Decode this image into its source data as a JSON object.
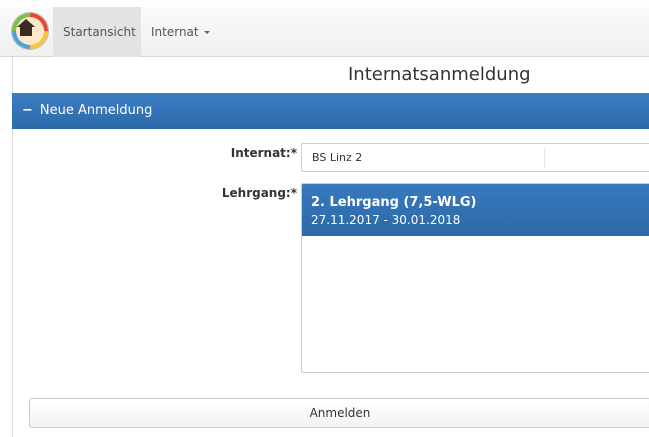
{
  "navbar": {
    "tabs": [
      {
        "label": "Startansicht",
        "active": true
      },
      {
        "label": "Internat",
        "dropdown": true
      }
    ]
  },
  "page": {
    "title": "Internatsanmeldung"
  },
  "section": {
    "collapse_symbol": "−",
    "title": "Neue Anmeldung",
    "color": "#2f6fae"
  },
  "form": {
    "internat": {
      "label": "Internat:*",
      "value": "BS Linz 2"
    },
    "lehrgang": {
      "label": "Lehrgang:*",
      "options": [
        {
          "title": "2. Lehrgang (7,5-WLG)",
          "dates": "27.11.2017 - 30.01.2018",
          "selected": true
        }
      ]
    },
    "submit_label": "Anmelden"
  },
  "icons": {
    "logo": "house-logo-icon",
    "dropdown": "caret-down-icon",
    "collapse": "minus-icon"
  }
}
